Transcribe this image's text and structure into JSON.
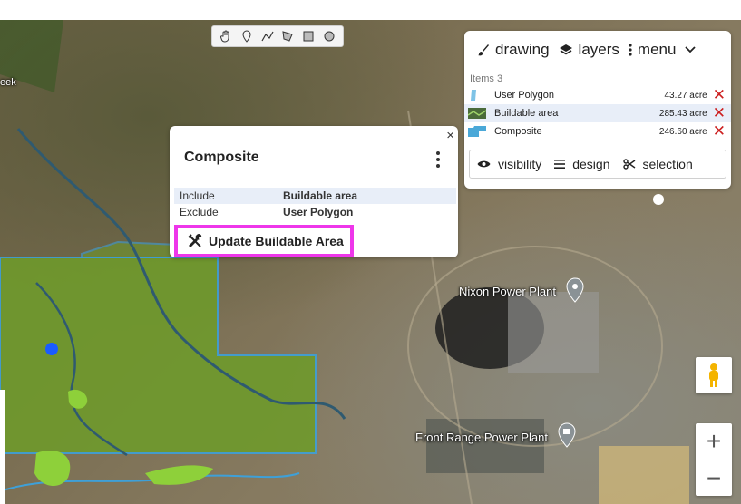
{
  "toolbar": {
    "tools": [
      "hand-pan",
      "pin",
      "polyline",
      "polygon",
      "rectangle",
      "circle"
    ]
  },
  "panel": {
    "tabs": {
      "drawing": "drawing",
      "layers": "layers",
      "menu": "menu"
    },
    "items_count": "Items 3",
    "items": [
      {
        "name": "User Polygon",
        "acres": "43.27 acre",
        "swatch_color": "#7ec3e6"
      },
      {
        "name": "Buildable area",
        "acres": "285.43 acre",
        "swatch_color": "#4a6b3a"
      },
      {
        "name": "Composite",
        "acres": "246.60 acre",
        "swatch_color": "#4aa8d8"
      }
    ],
    "bottom_tabs": {
      "visibility": "visibility",
      "design": "design",
      "selection": "selection"
    }
  },
  "popup": {
    "title": "Composite",
    "close": "×",
    "include_label": "Include",
    "include_value": "Buildable area",
    "exclude_label": "Exclude",
    "exclude_value": "User Polygon",
    "update_button": "Update Buildable Area"
  },
  "map": {
    "labels": {
      "nixon": "Nixon Power Plant",
      "front_range": "Front Range Power Plant",
      "creek": "eek"
    },
    "zoom_in": "+",
    "zoom_out": "−",
    "colors": {
      "buildable_fill": "#6f9a2c",
      "outline": "#3ea0d8",
      "highlight": "#ee36ea",
      "marker": "#1a5cff"
    }
  }
}
